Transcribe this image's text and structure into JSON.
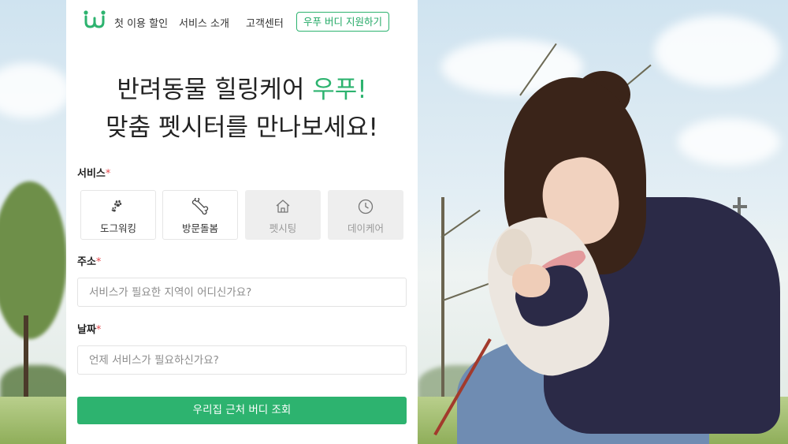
{
  "colors": {
    "accent": "#2db36f",
    "required": "#e5484d",
    "disabled_bg": "#eeeeee"
  },
  "nav": {
    "logo_icon": "woof-logo-icon",
    "links": [
      "첫 이용 할인",
      "서비스 소개",
      "고객센터"
    ],
    "cta": "우푸 버디 지원하기"
  },
  "headline": {
    "line1_prefix": "반려동물 힐링케어 ",
    "line1_accent": "우푸!",
    "line2": "맞춤 펫시터를 만나보세요!"
  },
  "form": {
    "service_label": "서비스",
    "required_mark": "*",
    "services": [
      {
        "label": "도그워킹",
        "icon": "paw-icon",
        "enabled": true
      },
      {
        "label": "방문돌봄",
        "icon": "bone-icon",
        "enabled": true
      },
      {
        "label": "펫시팅",
        "icon": "house-icon",
        "enabled": false
      },
      {
        "label": "데이케어",
        "icon": "clock-icon",
        "enabled": false
      }
    ],
    "address_label": "주소",
    "address_placeholder": "서비스가 필요한 지역이 어디신가요?",
    "date_label": "날짜",
    "date_placeholder": "언제 서비스가 필요하신가요?",
    "submit": "우리집 근처 버디 조회"
  }
}
